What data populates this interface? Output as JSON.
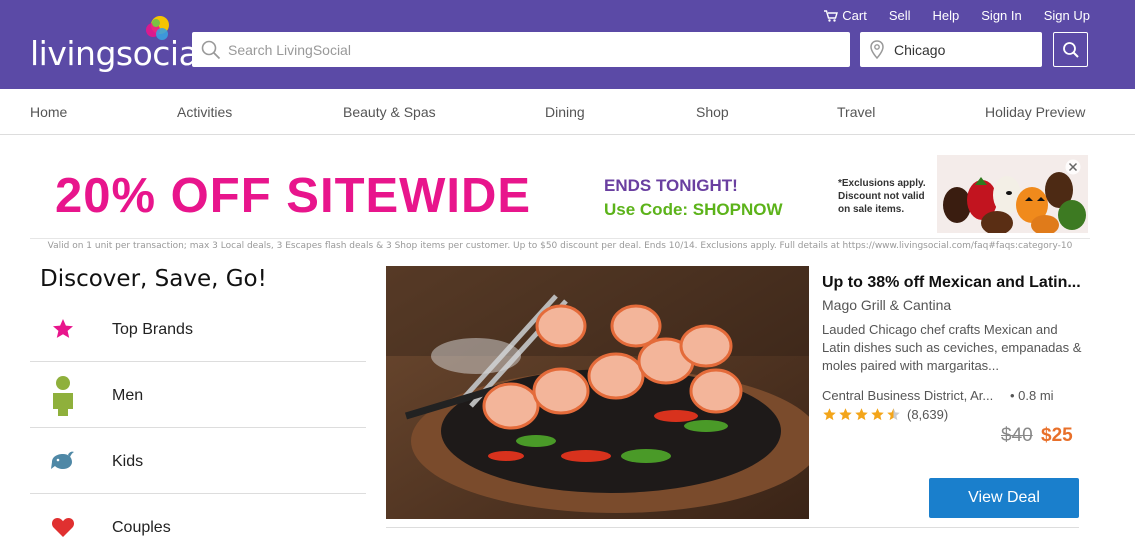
{
  "header": {
    "logo_text": "livingsocial",
    "util_links": [
      {
        "label": "Cart",
        "icon": "cart-icon"
      },
      {
        "label": "Sell"
      },
      {
        "label": "Help"
      },
      {
        "label": "Sign In"
      },
      {
        "label": "Sign Up"
      }
    ],
    "search_placeholder": "Search LivingSocial",
    "location_value": "Chicago",
    "colors": {
      "brand": "#5b4aa6"
    }
  },
  "nav": {
    "items": [
      "Home",
      "Activities",
      "Beauty & Spas",
      "Dining",
      "Shop",
      "Travel",
      "Holiday Preview"
    ]
  },
  "promo": {
    "headline": "20% OFF SITEWIDE",
    "ends": "ENDS TONIGHT!",
    "code": "Use Code: SHOPNOW",
    "exclusions": "*Exclusions apply. Discount not valid on sale items.",
    "fine_print": "Valid on 1 unit per transaction; max 3 Local deals, 3 Escapes flash deals & 3 Shop items per customer. Up to $50 discount per deal. Ends 10/14. Exclusions apply. Full details at https://www.livingsocial.com/faq#faqs:category-10"
  },
  "discover": {
    "title": "Discover, Save, Go!",
    "categories": [
      {
        "label": "Top Brands",
        "icon": "star-icon"
      },
      {
        "label": "Men",
        "icon": "man-icon"
      },
      {
        "label": "Kids",
        "icon": "whale-icon"
      },
      {
        "label": "Couples",
        "icon": "heart-icon"
      }
    ]
  },
  "deal": {
    "title": "Up to 38% off Mexican and Latin...",
    "merchant": "Mago Grill & Cantina",
    "description": "Lauded Chicago chef crafts Mexican and Latin dishes such as ceviches, empanadas & moles paired with margaritas...",
    "location": "Central Business District, Ar...",
    "distance": "• 0.8 mi",
    "rating": 4.5,
    "review_count": "(8,639)",
    "price_old": "$40",
    "price_new": "$25",
    "button": "View Deal"
  }
}
